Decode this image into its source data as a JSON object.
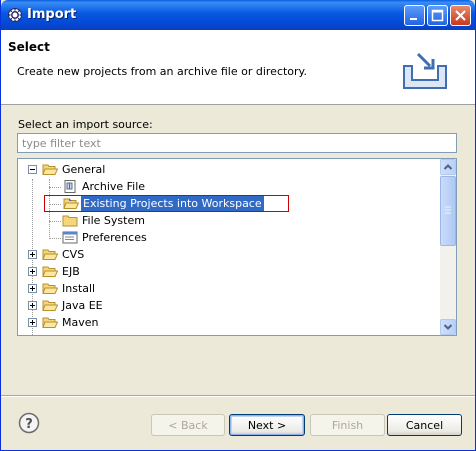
{
  "window": {
    "title": "Import",
    "title_icon": "eclipse-icon"
  },
  "banner": {
    "title": "Select",
    "description": "Create new projects from an archive file or directory.",
    "icon": "import-tray-icon"
  },
  "source": {
    "label": "Select an import source:",
    "filter_placeholder": "type filter text"
  },
  "tree": {
    "general": "General",
    "children": [
      "Archive File",
      "Existing Projects into Workspace",
      "File System",
      "Preferences"
    ],
    "top_level": [
      "CVS",
      "EJB",
      "Install",
      "Java EE",
      "Maven"
    ],
    "selected": "Existing Projects into Workspace"
  },
  "buttons": {
    "back": "< Back",
    "next": "Next >",
    "finish": "Finish",
    "cancel": "Cancel"
  },
  "colors": {
    "selection": "#316ac5",
    "highlight_box": "#d00000",
    "titlebar": "#0658e0"
  }
}
